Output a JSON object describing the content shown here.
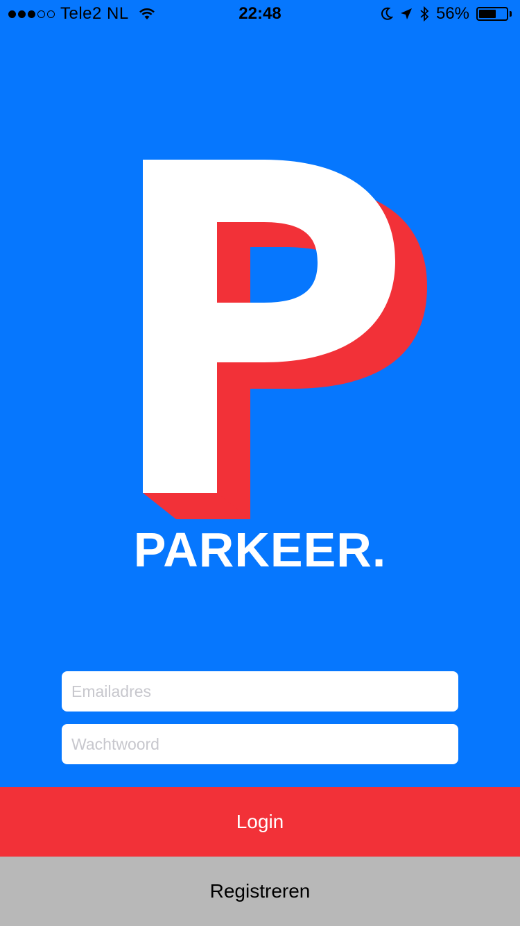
{
  "status_bar": {
    "carrier": "Tele2 NL",
    "signal_strength": 3,
    "time": "22:48",
    "battery_percent_label": "56%",
    "battery_level": 0.56
  },
  "logo": {
    "brand_text": "PARKEER.",
    "colors": {
      "background": "#0677FE",
      "letter": "#FFFFFF",
      "shadow": "#F23138"
    }
  },
  "form": {
    "email_placeholder": "Emailadres",
    "email_value": "",
    "password_placeholder": "Wachtwoord",
    "password_value": ""
  },
  "buttons": {
    "login_label": "Login",
    "register_label": "Registreren"
  },
  "colors": {
    "login": "#F23138",
    "register": "#B8B8B8"
  }
}
